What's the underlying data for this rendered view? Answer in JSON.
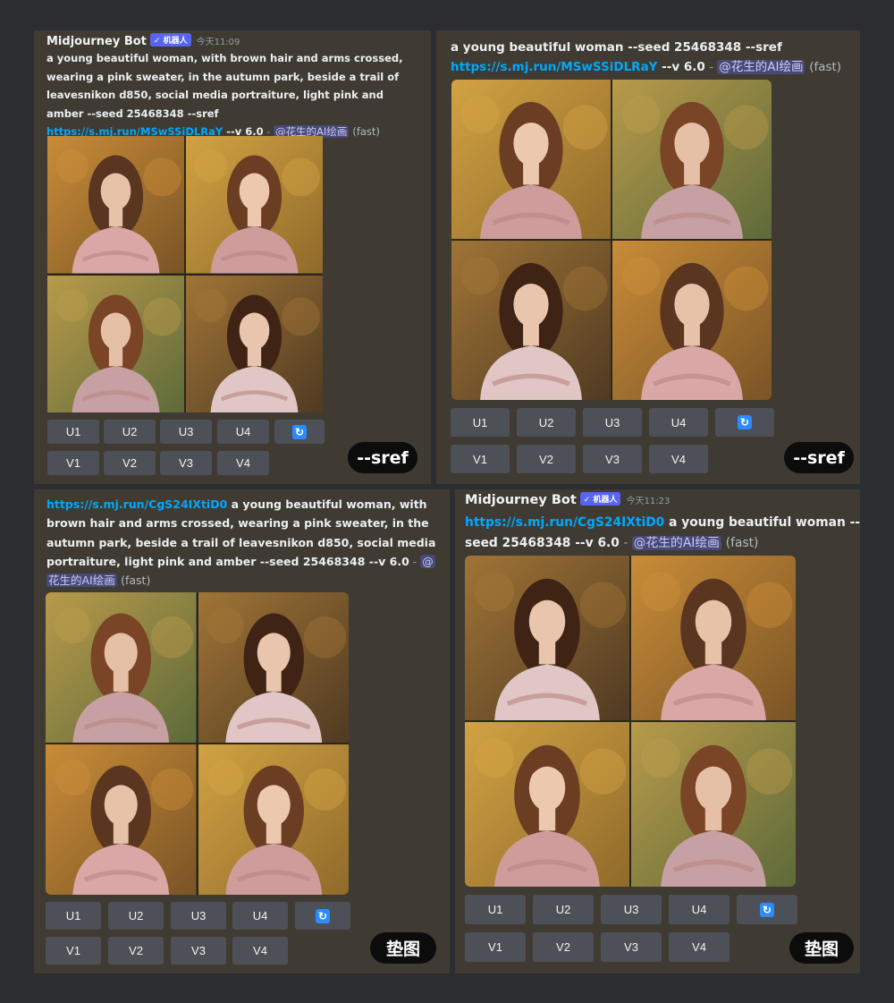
{
  "panel1": {
    "bot_name": "Midjourney Bot",
    "bot_badge": "✓ 机器人",
    "timestamp": "今天11:09",
    "prompt_l1": "a young beautiful woman, with brown hair and arms crossed,",
    "prompt_l2": "wearing a pink sweater, in the autumn park, beside a trail of",
    "prompt_l3": "leavesnikon d850, social media portraiture, light pink and",
    "prompt_l4": "amber --seed 25468348 --sref",
    "link": "https://s.mj.run/MSwSSiDLRaY",
    "params": " --v 6.0",
    "sep": " - ",
    "mention": "@花生的AI绘画",
    "speed": "(fast)",
    "buttons_row1": [
      "U1",
      "U2",
      "U3",
      "U4"
    ],
    "buttons_row2": [
      "V1",
      "V2",
      "V3",
      "V4"
    ],
    "refresh_icon": "refresh-icon",
    "tag": "--sref"
  },
  "panel2": {
    "prompt_l1": "a young beautiful woman --seed 25468348 --sref",
    "link": "https://s.mj.run/MSwSSiDLRaY",
    "params": " --v 6.0",
    "sep": " - ",
    "mention": "@花生的AI绘画",
    "speed": "(fast)",
    "buttons_row1": [
      "U1",
      "U2",
      "U3",
      "U4"
    ],
    "buttons_row2": [
      "V1",
      "V2",
      "V3",
      "V4"
    ],
    "refresh_icon": "refresh-icon",
    "tag": "--sref"
  },
  "panel3": {
    "link": "https://s.mj.run/CgS24IXtiD0",
    "prompt_l1": " a young beautiful woman, with",
    "prompt_l2": "brown hair and arms crossed, wearing a pink sweater, in the",
    "prompt_l3": "autumn park, beside a trail of leavesnikon d850, social media",
    "prompt_l4": "portraiture, light pink and amber --seed 25468348 --v 6.0",
    "sep": " - ",
    "mention_a": "@",
    "mention_b": "花生的AI绘画",
    "speed": "(fast)",
    "buttons_row1": [
      "U1",
      "U2",
      "U3",
      "U4"
    ],
    "buttons_row2": [
      "V1",
      "V2",
      "V3",
      "V4"
    ],
    "refresh_icon": "refresh-icon",
    "tag": "垫图"
  },
  "panel4": {
    "bot_name": "Midjourney Bot",
    "bot_badge": "✓ 机器人",
    "timestamp": "今天11:23",
    "link": "https://s.mj.run/CgS24IXtiD0",
    "prompt_l1": " a young beautiful woman --",
    "prompt_l2": "seed 25468348 --v 6.0",
    "sep": " - ",
    "mention": "@花生的AI绘画",
    "speed": "(fast)",
    "buttons_row1": [
      "U1",
      "U2",
      "U3",
      "U4"
    ],
    "buttons_row2": [
      "V1",
      "V2",
      "V3",
      "V4"
    ],
    "refresh_icon": "refresh-icon",
    "tag": "垫图"
  },
  "colors": {
    "page_bg": "#2b2d31",
    "panel_bg": "#3f3b33",
    "link": "#00a8fc",
    "button": "#4e5058",
    "badge": "#5865f2",
    "tag_bg": "#0c0c0c"
  }
}
